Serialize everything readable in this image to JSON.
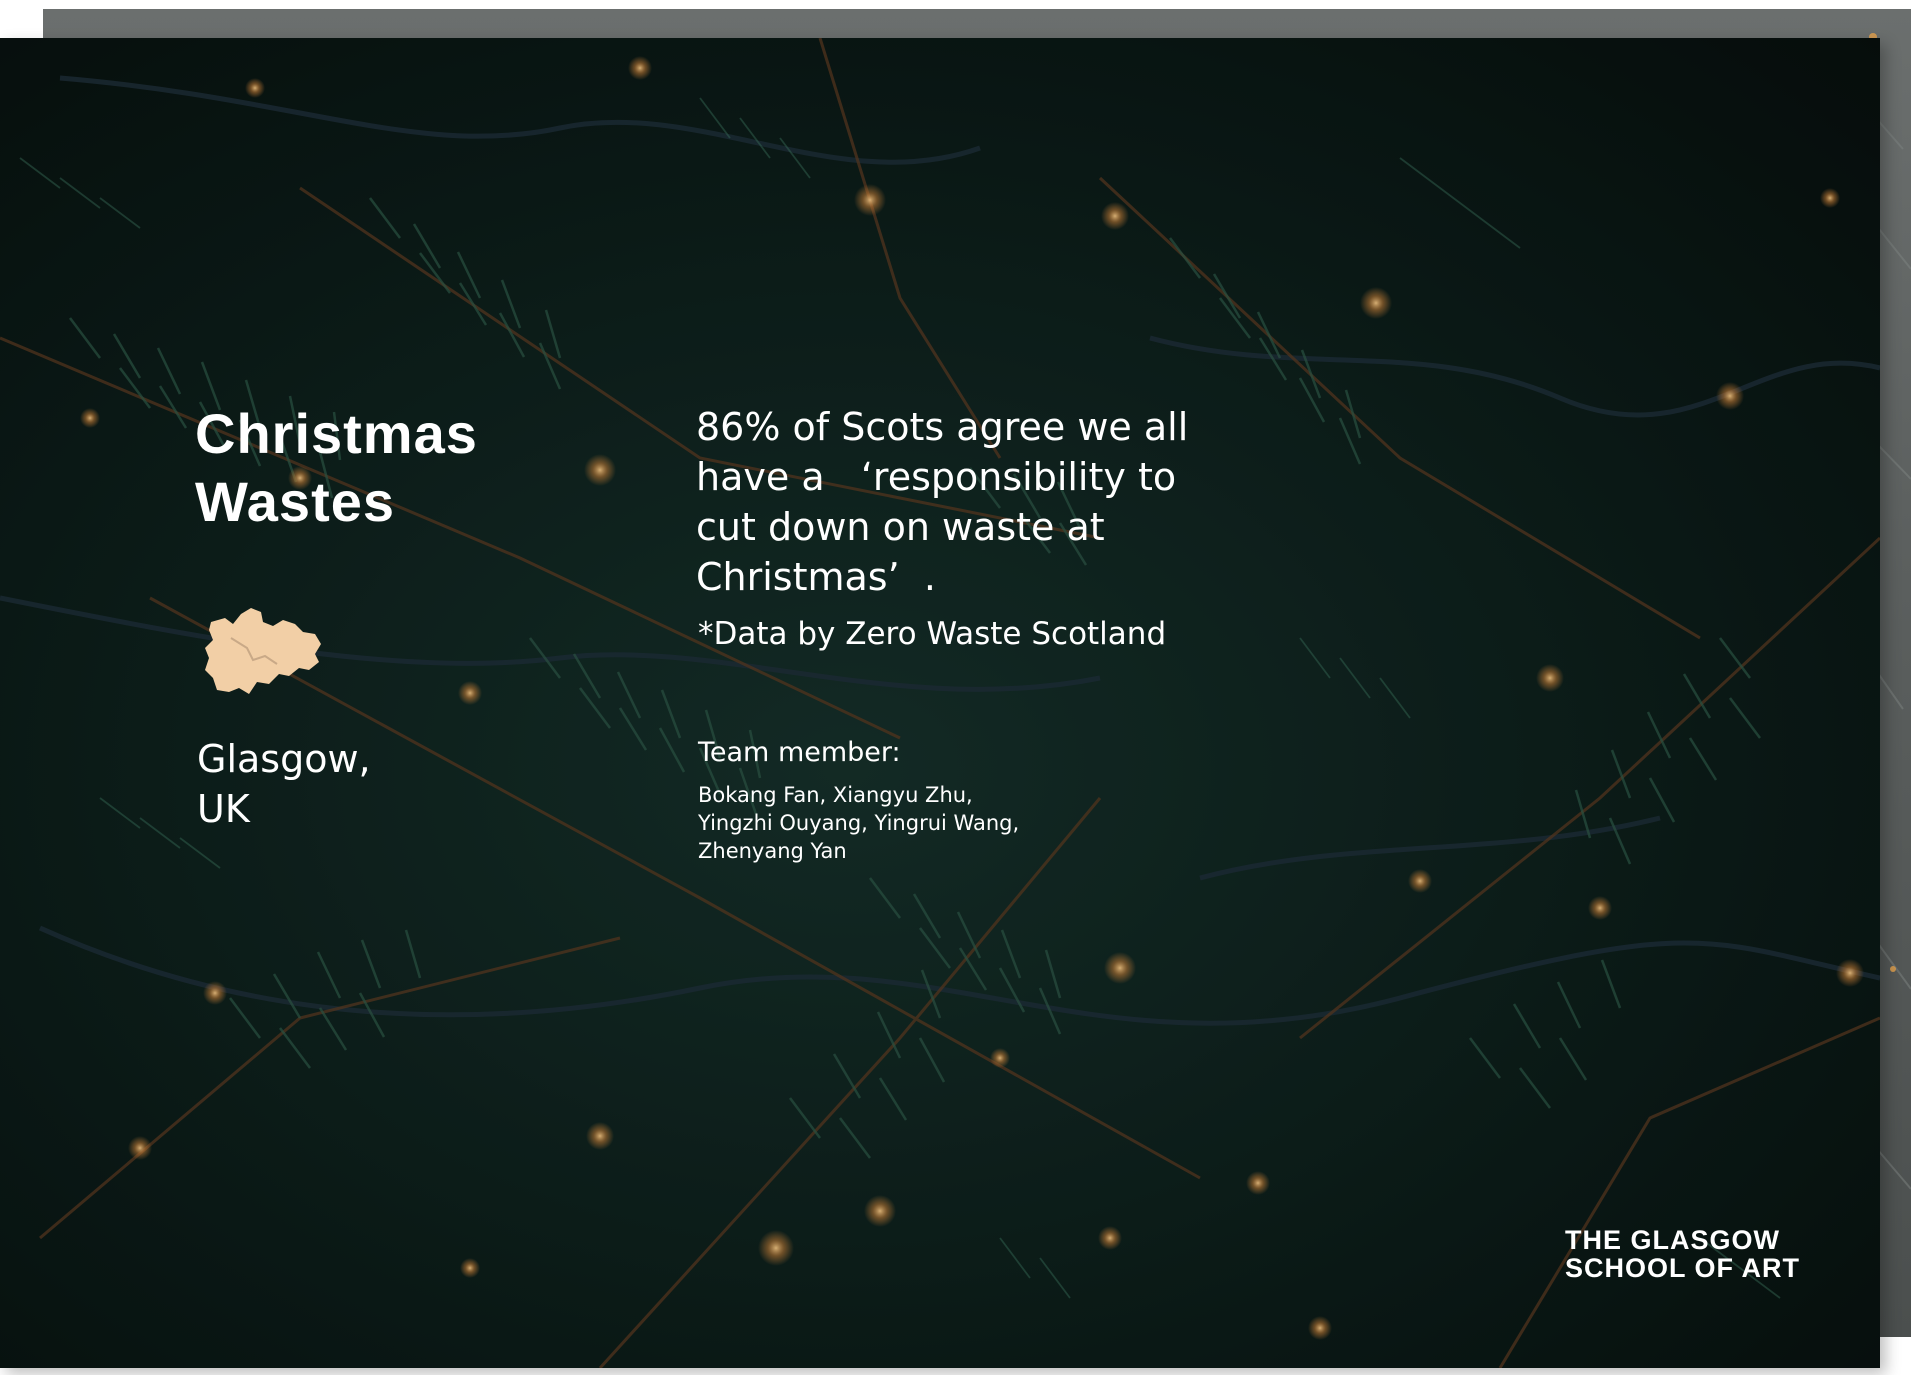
{
  "title": {
    "line1": "Christmas",
    "line2": "Wastes"
  },
  "location": {
    "line1": "Glasgow,",
    "line2": "UK"
  },
  "statistic": {
    "line1": "86% of Scots agree we all",
    "line2": "have a   ‘responsibility to",
    "line3": "cut down on waste at",
    "line4": "Christmas’  ."
  },
  "source_note": "*Data by Zero Waste Scotland",
  "team": {
    "label": "Team member:",
    "line1": "Bokang Fan, Xiangyu Zhu,",
    "line2": "Yingzhi Ouyang, Yingrui Wang,",
    "line3": "Zhenyang Yan"
  },
  "logo": {
    "line1": "THE GLASGOW",
    "line2": "SCHOOL OF ART"
  },
  "icons": {
    "map": "glasgow-map-icon"
  },
  "colors": {
    "background": "#0b1a16",
    "text": "#ffffff",
    "map_fill": "#f2cfa6",
    "light_glow": "#d98a3c"
  }
}
